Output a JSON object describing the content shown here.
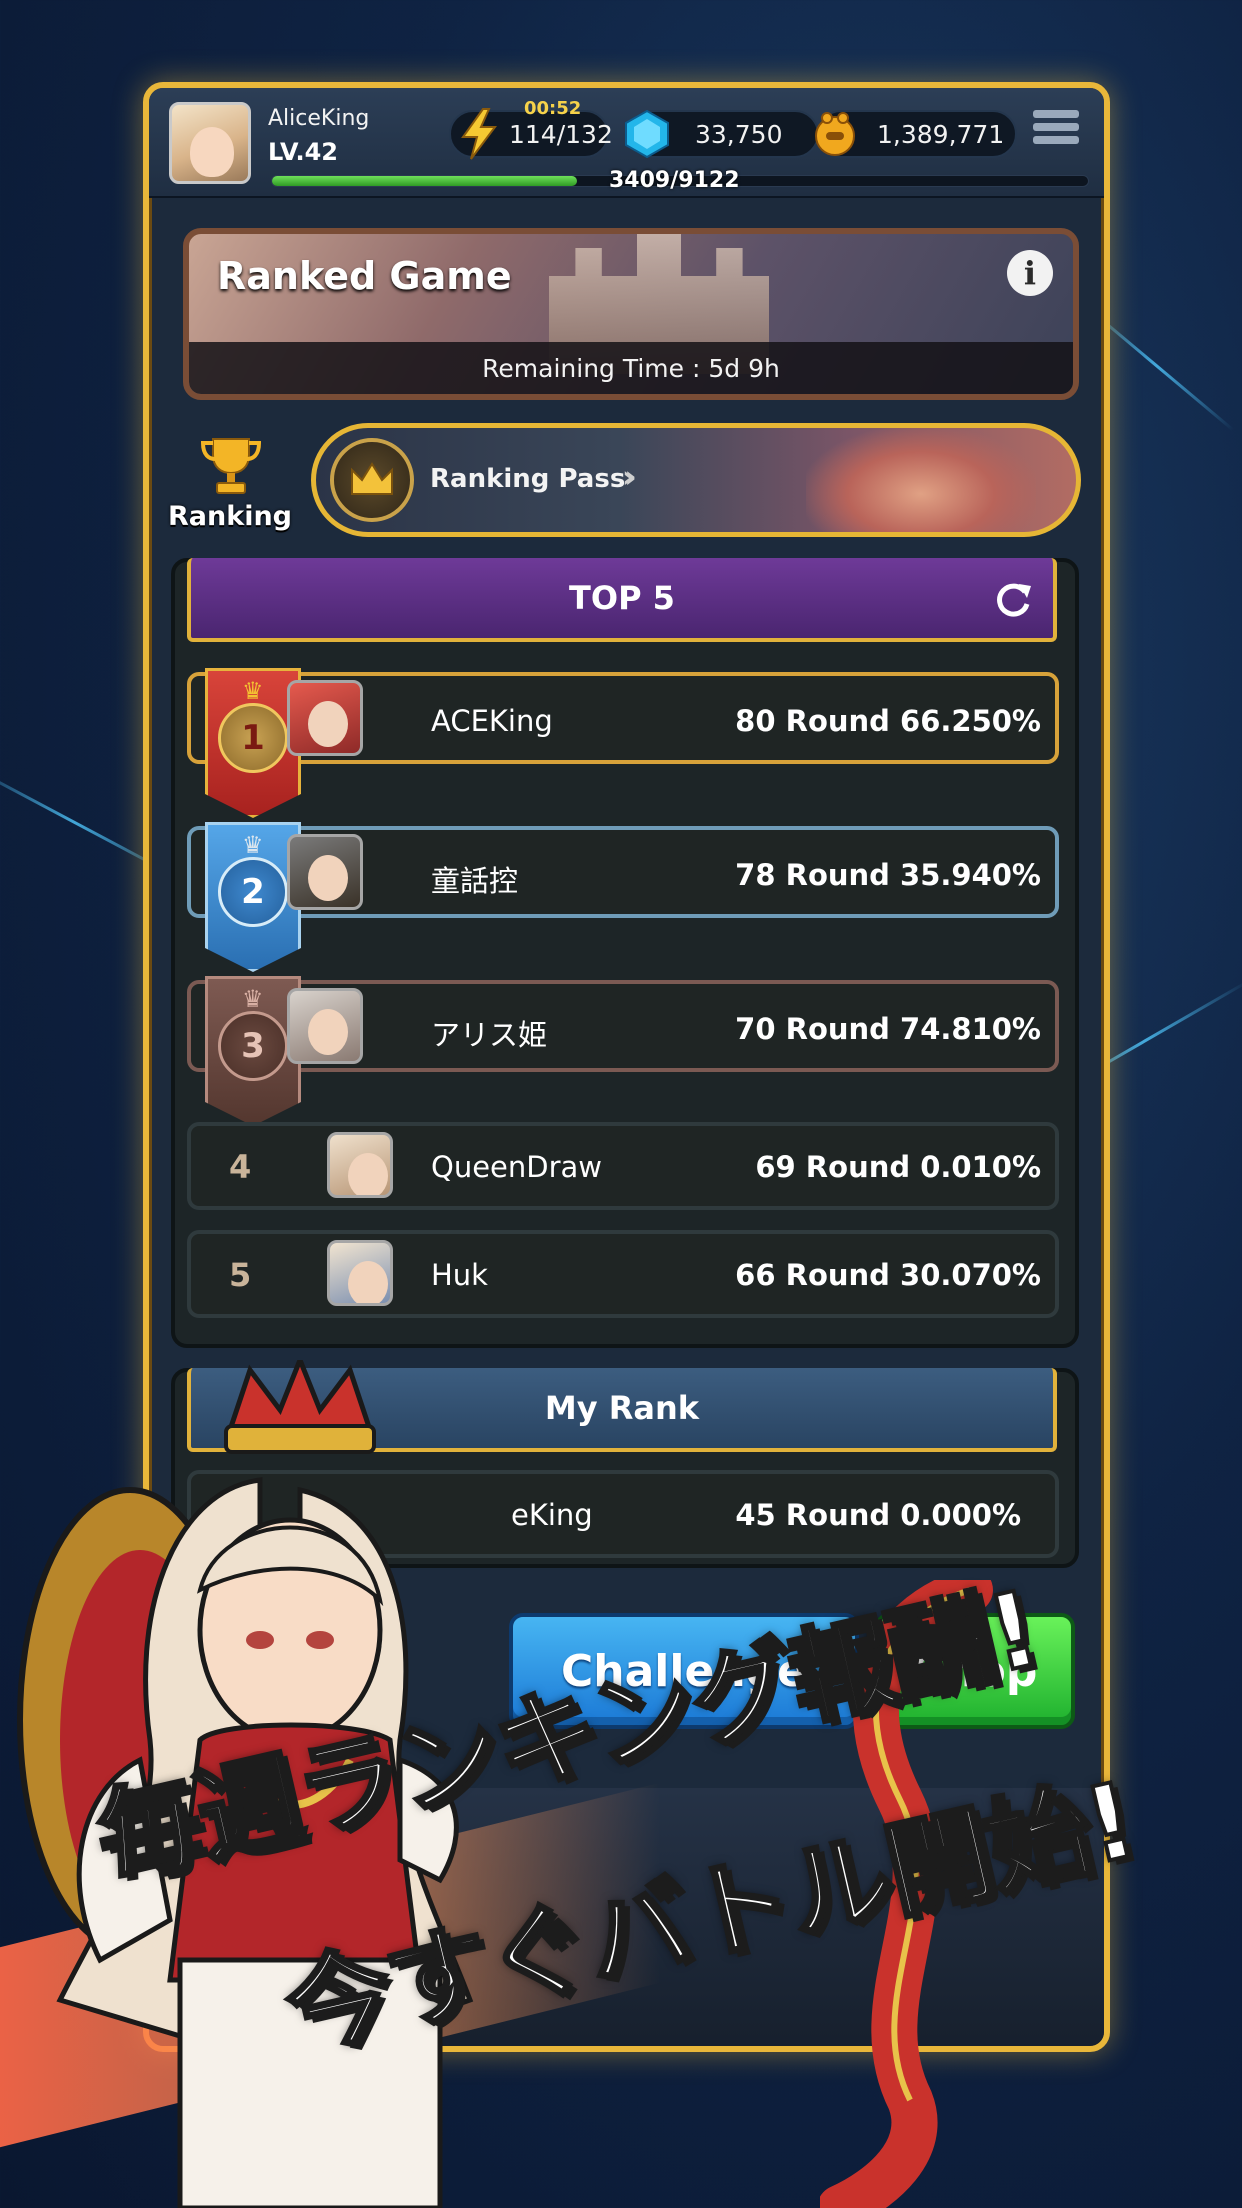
{
  "player": {
    "name": "AliceKing",
    "level": "LV.42",
    "xp_text": "3409/9122",
    "xp_fraction": 0.374
  },
  "resources": {
    "energy_timer": "00:52",
    "energy": "114/132",
    "gems": "33,750",
    "coins": "1,389,771"
  },
  "ranked_game": {
    "title": "Ranked Game",
    "remaining": "Remaining Time : 5d 9h"
  },
  "ranking": {
    "label": "Ranking",
    "pass_label": "Ranking Pass"
  },
  "top5": {
    "title": "TOP 5",
    "rows": [
      {
        "rank": "1",
        "name": "ACEKing",
        "score": "80 Round 66.250%"
      },
      {
        "rank": "2",
        "name": "童話控",
        "score": "78 Round 35.940%"
      },
      {
        "rank": "3",
        "name": "アリス姫",
        "score": "70 Round 74.810%"
      },
      {
        "rank": "4",
        "name": "QueenDraw",
        "score": "69 Round 0.010%"
      },
      {
        "rank": "5",
        "name": "Huk",
        "score": "66 Round 30.070%"
      }
    ]
  },
  "my_rank": {
    "title": "My Rank",
    "name": "eKing",
    "score": "45 Round 0.000%"
  },
  "buttons": {
    "challenge": "Challenge",
    "shop": "Shop"
  },
  "promo": {
    "line1": "毎週ランキング報酬!",
    "line2": "今すぐバトル開始!"
  },
  "colors": {
    "frame_gold": "#e9b73a",
    "top5_purple": "#5a2e85",
    "myrank_blue": "#2f4d6e",
    "challenge_blue": "#2a8ee4",
    "shop_green": "#3ccf3c",
    "rank1": "#c8322f",
    "rank2": "#3e86c9",
    "rank3": "#6d4a43"
  },
  "icons": {
    "energy": "lightning-icon",
    "gems": "gem-icon",
    "coins": "coin-icon",
    "menu": "menu-icon",
    "info": "info-icon",
    "trophy": "trophy-icon",
    "refresh": "refresh-icon"
  }
}
